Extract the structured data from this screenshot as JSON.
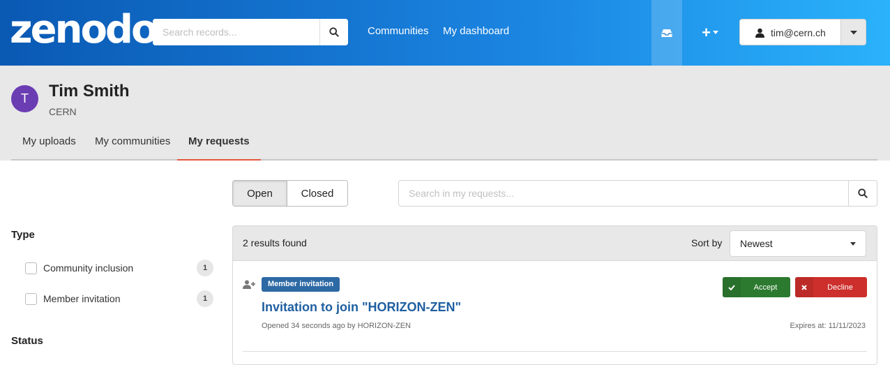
{
  "header": {
    "logo": "zenodo",
    "search_placeholder": "Search records...",
    "nav": [
      "Communities",
      "My dashboard"
    ],
    "user_email": "tim@cern.ch",
    "plus_label": "+"
  },
  "profile": {
    "avatar_letter": "T",
    "name": "Tim Smith",
    "org": "CERN",
    "tabs": [
      {
        "label": "My uploads",
        "active": false
      },
      {
        "label": "My communities",
        "active": false
      },
      {
        "label": "My requests",
        "active": true
      }
    ]
  },
  "filters": {
    "open_label": "Open",
    "closed_label": "Closed",
    "search_placeholder": "Search in my requests..."
  },
  "facets": {
    "type_title": "Type",
    "type_items": [
      {
        "label": "Community inclusion",
        "count": "1"
      },
      {
        "label": "Member invitation",
        "count": "1"
      }
    ],
    "status_title": "Status"
  },
  "results": {
    "count_text": "2 results found",
    "sort_label": "Sort by",
    "sort_value": "Newest",
    "items": [
      {
        "badge": "Member invitation",
        "title": "Invitation to join \"HORIZON-ZEN\"",
        "meta": "Opened 34 seconds ago by HORIZON-ZEN",
        "expires": "Expires at: 11/11/2023",
        "accept_label": "Accept",
        "decline_label": "Decline"
      }
    ]
  },
  "colors": {
    "header_start": "#0a59b3",
    "header_end": "#2ab2fb",
    "accent_tab": "#e4583e",
    "badge": "#2d69a4",
    "accept": "#2c7a2f",
    "decline": "#cc2f2c",
    "title": "#1f5fa1"
  }
}
